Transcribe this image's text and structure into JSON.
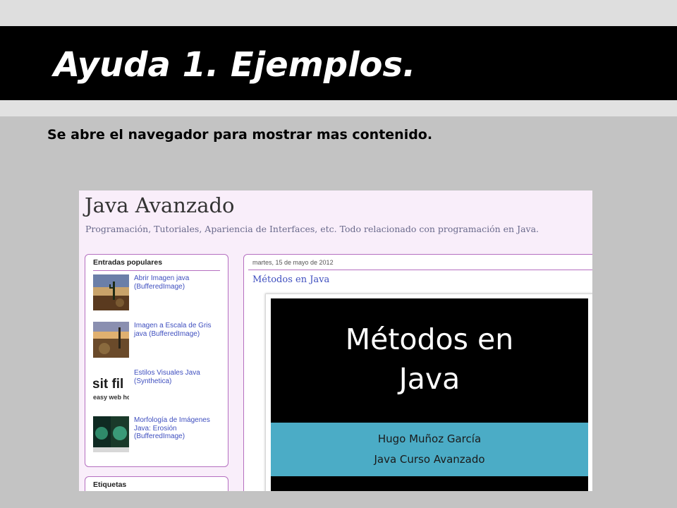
{
  "slide": {
    "title": "Ayuda 1. Ejemplos.",
    "subtitle": "Se abre el navegador para mostrar mas contenido."
  },
  "blog": {
    "title": "Java Avanzado",
    "description": "Programación, Tutoriales, Apariencia de Interfaces, etc. Todo relacionado con programación en Java.",
    "popular": {
      "heading": "Entradas populares",
      "items": [
        {
          "title": "Abrir Imagen java (BufferedImage)",
          "thumb": "landscape-cactus-thumb"
        },
        {
          "title": "Imagen a Escala de Gris java (BufferedImage)",
          "thumb": "landscape-sunset-thumb"
        },
        {
          "title": "Estilos Visuales Java (Synthetica)",
          "thumb": "website-logo-thumb",
          "thumb_text_1": "sit fil",
          "thumb_text_2": "easy web ho"
        },
        {
          "title": "Morfología de Imágenes Java: Erosión (BufferedImage)",
          "thumb": "morphology-thumb"
        }
      ]
    },
    "tags_heading": "Etiquetas",
    "post": {
      "date": "martes, 15 de mayo de 2012",
      "title": "Métodos en Java",
      "embedded_slide": {
        "title_line1": "Métodos en",
        "title_line2": "Java",
        "author": "Hugo Muñoz García",
        "course": "Java Curso Avanzado"
      }
    }
  },
  "colors": {
    "title_bar": "#000000",
    "slide_bg": "#c3c3c3",
    "blog_bg": "#f9eefa",
    "widget_border": "#b56fc0",
    "link": "#3f4fbf",
    "embed_band": "#4bacc6"
  }
}
